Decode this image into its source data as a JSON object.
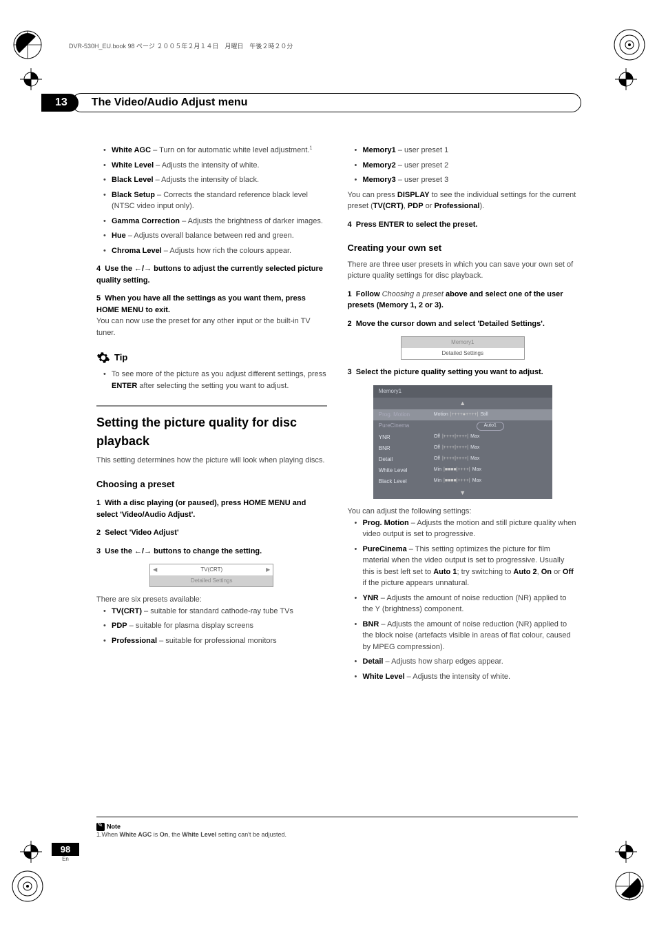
{
  "header_line": "DVR-530H_EU.book  98 ページ  ２００５年２月１４日　月曜日　午後２時２０分",
  "chapter": {
    "num": "13",
    "title": "The Video/Audio Adjust menu"
  },
  "left": {
    "bullets1": [
      {
        "term": "White AGC",
        "desc": " – Turn on for automatic white level adjustment.",
        "sup": "1"
      },
      {
        "term": "White Level",
        "desc": " – Adjusts the intensity of white."
      },
      {
        "term": "Black Level",
        "desc": " – Adjusts the intensity of black."
      },
      {
        "term": "Black Setup",
        "desc": " – Corrects the standard reference black level (NTSC video input only)."
      },
      {
        "term": "Gamma Correction",
        "desc": " – Adjusts the brightness of darker images."
      },
      {
        "term": "Hue",
        "desc": " – Adjusts overall balance between red and green."
      },
      {
        "term": "Chroma Level",
        "desc": " – Adjusts how rich the colours appear."
      }
    ],
    "step4": {
      "num": "4",
      "text": "Use the ←/→ buttons to adjust the currently selected picture quality setting."
    },
    "step5": {
      "num": "5",
      "text": "When you have all the settings as you want them, press HOME MENU to exit."
    },
    "step5_after": "You can now use the preset for any other input or the built-in TV tuner.",
    "tip_label": "Tip",
    "tip_text_a": "To see more of the picture as you adjust different settings, press ",
    "tip_text_b": "ENTER",
    "tip_text_c": " after selecting the setting you want to adjust.",
    "section_title": "Setting the picture quality for disc playback",
    "section_desc": "This setting determines how the picture will look when playing discs.",
    "sub_choosing": "Choosing a preset",
    "c_step1": {
      "num": "1",
      "text": "With a disc playing (or paused), press HOME MENU and select 'Video/Audio Adjust'."
    },
    "c_step2": {
      "num": "2",
      "text": "Select 'Video Adjust'"
    },
    "c_step3": {
      "num": "3",
      "text": "Use the ←/→ buttons to change the setting."
    },
    "preset_box": {
      "tv": "TV(CRT)",
      "detailed": "Detailed Settings"
    },
    "presets_intro": "There are six presets available:",
    "presets": [
      {
        "term": "TV(CRT)",
        "desc": " – suitable for standard cathode-ray tube TVs"
      },
      {
        "term": "PDP",
        "desc": " – suitable for plasma display screens"
      },
      {
        "term": "Professional",
        "desc": " – suitable for professional monitors"
      }
    ]
  },
  "right": {
    "presets2": [
      {
        "term": "Memory1",
        "desc": " – user preset 1"
      },
      {
        "term": "Memory2",
        "desc": " – user preset 2"
      },
      {
        "term": "Memory3",
        "desc": " – user preset 3"
      }
    ],
    "display_a": "You can press ",
    "display_b": "DISPLAY",
    "display_c": " to see the individual settings for the current preset (",
    "display_d": "TV(CRT)",
    "display_e": ", ",
    "display_f": "PDP",
    "display_g": " or ",
    "display_h": "Professional",
    "display_i": ").",
    "r_step4": {
      "num": "4",
      "text": "Press ENTER to select the preset."
    },
    "sub_creating": "Creating your own set",
    "creating_desc": "There are three user presets in which you can save your own set of picture quality settings for disc playback.",
    "r2_step1_num": "1",
    "r2_step1_a": "Follow ",
    "r2_step1_b": "Choosing a preset",
    "r2_step1_c": " above and select one of the user presets (Memory 1, 2 or 3).",
    "r2_step2": {
      "num": "2",
      "text": "Move the cursor down and select 'Detailed Settings'."
    },
    "mem_box": {
      "mem": "Memory1",
      "detailed": "Detailed Settings"
    },
    "r2_step3": {
      "num": "3",
      "text": "Select the picture quality setting you want to adjust."
    },
    "table": {
      "title": "Memory1",
      "rows": [
        {
          "label": "Prog. Motion",
          "left": "Motion",
          "right": "Still",
          "faded": true
        },
        {
          "label": "PureCinema",
          "pill": "Auto1",
          "faded": true
        },
        {
          "label": "YNR",
          "left": "Off",
          "right": "Max"
        },
        {
          "label": "BNR",
          "left": "Off",
          "right": "Max"
        },
        {
          "label": "Detail",
          "left": "Off",
          "right": "Max"
        },
        {
          "label": "White Level",
          "left": "Min",
          "right": "Max"
        },
        {
          "label": "Black Level",
          "left": "Min",
          "right": "Max"
        }
      ]
    },
    "adjust_intro": "You can adjust the following settings:",
    "adjust": [
      {
        "term": "Prog. Motion",
        "desc": " – Adjusts the motion and still picture quality when video output is set to progressive."
      },
      {
        "term": "PureCinema",
        "desc_a": " – This setting optimizes the picture for film material when the video output is set to progressive. Usually this is best left set to ",
        "b1": "Auto 1",
        "d2": "; try switching to ",
        "b2": "Auto 2",
        "d3": ", ",
        "b3": "On",
        "d4": " or ",
        "b4": "Off",
        "d5": " if the picture appears unnatural."
      },
      {
        "term": "YNR",
        "desc": " – Adjusts the amount of noise reduction (NR) applied to the Y (brightness) component."
      },
      {
        "term": "BNR",
        "desc": " – Adjusts the amount of noise reduction (NR) applied to the block noise (artefacts visible in areas of flat colour, caused by MPEG compression)."
      },
      {
        "term": "Detail",
        "desc": " – Adjusts how sharp edges appear."
      },
      {
        "term": "White Level",
        "desc": " – Adjusts the intensity of white."
      }
    ]
  },
  "footnote": {
    "label": "Note",
    "text_a": "1.When ",
    "text_b": "White AGC",
    "text_c": " is ",
    "text_d": "On",
    "text_e": ", the ",
    "text_f": "White Level",
    "text_g": " setting can't be adjusted."
  },
  "page": {
    "num": "98",
    "lang": "En"
  }
}
